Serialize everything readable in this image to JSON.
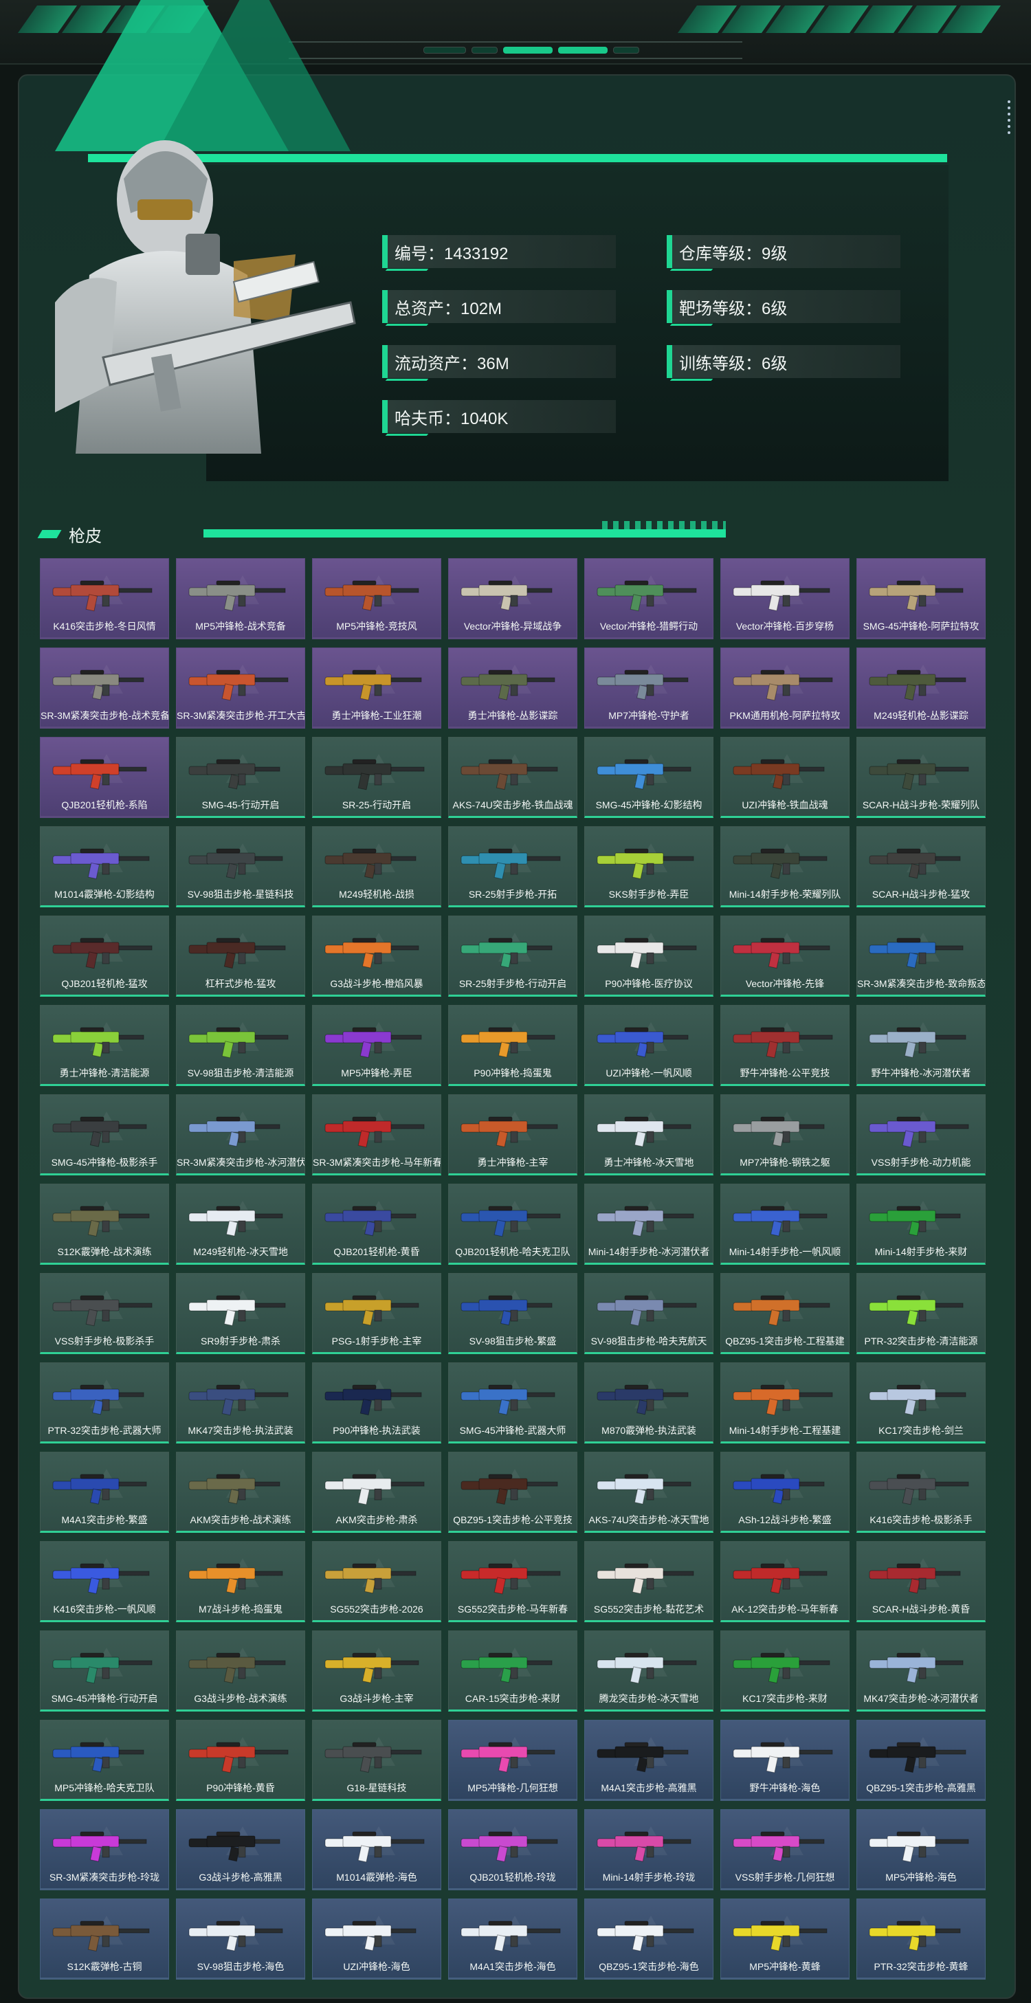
{
  "player": {
    "id": "编号：1433192",
    "total_assets": "总资产：102M",
    "liquid_assets": "流动资产：36M",
    "currency": "哈夫币：1040K",
    "warehouse_level": "仓库等级：9级",
    "range_level": "靶场等级：6级",
    "training_level": "训练等级：6级"
  },
  "section": {
    "title": "枪皮"
  },
  "colors": {
    "accent": "#1ee39c",
    "rarity_purple": "#6a548f",
    "rarity_green": "#3c5b53",
    "rarity_blue": "#44597a"
  },
  "skins": [
    {
      "name": "K416突击步枪-冬日风情",
      "rarity": "purple",
      "color": "#b24a3a"
    },
    {
      "name": "MP5冲锋枪-战术竞备",
      "rarity": "purple",
      "color": "#8a8f88"
    },
    {
      "name": "MP5冲锋枪-竞技风",
      "rarity": "purple",
      "color": "#b8552c"
    },
    {
      "name": "Vector冲锋枪-异域战争",
      "rarity": "purple",
      "color": "#c9c3b0"
    },
    {
      "name": "Vector冲锋枪-猎鳄行动",
      "rarity": "purple",
      "color": "#4f8f5a"
    },
    {
      "name": "Vector冲锋枪-百步穿杨",
      "rarity": "purple",
      "color": "#e7e7e7"
    },
    {
      "name": "SMG-45冲锋枪-阿萨拉特攻",
      "rarity": "purple",
      "color": "#b7a37a"
    },
    {
      "name": "SR-3M紧凑突击步枪-战术竞备",
      "rarity": "purple",
      "color": "#8a8a80"
    },
    {
      "name": "SR-3M紧凑突击步枪-开工大吉",
      "rarity": "purple",
      "color": "#c9552f"
    },
    {
      "name": "勇士冲锋枪-工业狂潮",
      "rarity": "purple",
      "color": "#c8952a"
    },
    {
      "name": "勇士冲锋枪-丛影谍踪",
      "rarity": "purple",
      "color": "#5c6a4a"
    },
    {
      "name": "MP7冲锋枪-守护者",
      "rarity": "purple",
      "color": "#7a8a9a"
    },
    {
      "name": "PKM通用机枪-阿萨拉特攻",
      "rarity": "purple",
      "color": "#a88b6a"
    },
    {
      "name": "M249轻机枪-丛影谍踪",
      "rarity": "purple",
      "color": "#4e5a3c"
    },
    {
      "name": "QJB201轻机枪-系陷",
      "rarity": "purple",
      "color": "#d0402a"
    },
    {
      "name": "SMG-45-行动开启",
      "rarity": "green",
      "color": "#3b3f3e"
    },
    {
      "name": "SR-25-行动开启",
      "rarity": "green",
      "color": "#2f3432"
    },
    {
      "name": "AKS-74U突击步枪-铁血战魂",
      "rarity": "green",
      "color": "#6b4a35"
    },
    {
      "name": "SMG-45冲锋枪-幻影结构",
      "rarity": "green",
      "color": "#3f8ed8"
    },
    {
      "name": "UZI冲锋枪-铁血战魂",
      "rarity": "green",
      "color": "#7a3a22"
    },
    {
      "name": "SCAR-H战斗步枪-荣耀列队",
      "rarity": "green",
      "color": "#3d4a3b"
    },
    {
      "name": "M1014霰弹枪-幻影结构",
      "rarity": "green",
      "color": "#6b5bd0"
    },
    {
      "name": "SV-98狙击步枪-星链科技",
      "rarity": "green",
      "color": "#3e4547"
    },
    {
      "name": "M249轻机枪-战损",
      "rarity": "green",
      "color": "#4a3a30"
    },
    {
      "name": "SR-25射手步枪-开拓",
      "rarity": "green",
      "color": "#2f8fb0"
    },
    {
      "name": "SKS射手步枪-弄臣",
      "rarity": "green",
      "color": "#a8d038"
    },
    {
      "name": "Mini-14射手步枪-荣耀列队",
      "rarity": "green",
      "color": "#3a4438"
    },
    {
      "name": "SCAR-H战斗步枪-猛攻",
      "rarity": "green",
      "color": "#40403e"
    },
    {
      "name": "QJB201轻机枪-猛攻",
      "rarity": "green",
      "color": "#5a2b2b"
    },
    {
      "name": "杠杆式步枪-猛攻",
      "rarity": "green",
      "color": "#4a2a24"
    },
    {
      "name": "G3战斗步枪-橙焰风暴",
      "rarity": "green",
      "color": "#e4762a"
    },
    {
      "name": "SR-25射手步枪-行动开启",
      "rarity": "green",
      "color": "#37a878"
    },
    {
      "name": "P90冲锋枪-医疗协议",
      "rarity": "green",
      "color": "#e8e8e8"
    },
    {
      "name": "Vector冲锋枪-先锋",
      "rarity": "green",
      "color": "#c03040"
    },
    {
      "name": "SR-3M紧凑突击步枪-致命叛态",
      "rarity": "green",
      "color": "#2a6bc0"
    },
    {
      "name": "勇士冲锋枪-清洁能源",
      "rarity": "green",
      "color": "#8ad03a"
    },
    {
      "name": "SV-98狙击步枪-清洁能源",
      "rarity": "green",
      "color": "#7ac43a"
    },
    {
      "name": "MP5冲锋枪-弄臣",
      "rarity": "green",
      "color": "#8a3ad0"
    },
    {
      "name": "P90冲锋枪-捣蛋鬼",
      "rarity": "green",
      "color": "#e89a2a"
    },
    {
      "name": "UZI冲锋枪-一帆风顺",
      "rarity": "green",
      "color": "#3a5ad0"
    },
    {
      "name": "野牛冲锋枪-公平竞技",
      "rarity": "green",
      "color": "#a03030"
    },
    {
      "name": "野牛冲锋枪-冰河潜伏者",
      "rarity": "green",
      "color": "#9ab0c8"
    },
    {
      "name": "SMG-45冲锋枪-极影杀手",
      "rarity": "green",
      "color": "#3a3e40"
    },
    {
      "name": "SR-3M紧凑突击步枪-冰河潜伏者",
      "rarity": "green",
      "color": "#7a9ad0"
    },
    {
      "name": "SR-3M紧凑突击步枪-马年新春",
      "rarity": "green",
      "color": "#c02a2a"
    },
    {
      "name": "勇士冲锋枪-主宰",
      "rarity": "green",
      "color": "#c85a2a"
    },
    {
      "name": "勇士冲锋枪-冰天雪地",
      "rarity": "green",
      "color": "#dfe6ee"
    },
    {
      "name": "MP7冲锋枪-钢铁之躯",
      "rarity": "green",
      "color": "#9a9ea0"
    },
    {
      "name": "VSS射手步枪-动力机能",
      "rarity": "green",
      "color": "#6a5ad0"
    },
    {
      "name": "S12K霰弹枪-战术演练",
      "rarity": "green",
      "color": "#6a6a48"
    },
    {
      "name": "M249轻机枪-冰天雪地",
      "rarity": "green",
      "color": "#e6ecf2"
    },
    {
      "name": "QJB201轻机枪-黄昏",
      "rarity": "green",
      "color": "#3a4aa0"
    },
    {
      "name": "QJB201轻机枪-哈夫克卫队",
      "rarity": "green",
      "color": "#2a56b0"
    },
    {
      "name": "Mini-14射手步枪-冰河潜伏者",
      "rarity": "green",
      "color": "#9aa6c8"
    },
    {
      "name": "Mini-14射手步枪-一帆风顺",
      "rarity": "green",
      "color": "#3a62d0"
    },
    {
      "name": "Mini-14射手步枪-来财",
      "rarity": "green",
      "color": "#2aa03a"
    },
    {
      "name": "VSS射手步枪-极影杀手",
      "rarity": "green",
      "color": "#4a4e50"
    },
    {
      "name": "SR9射手步枪-肃杀",
      "rarity": "green",
      "color": "#eef2f4"
    },
    {
      "name": "PSG-1射手步枪-主宰",
      "rarity": "green",
      "color": "#c8a02a"
    },
    {
      "name": "SV-98狙击步枪-繁盛",
      "rarity": "green",
      "color": "#2a52b0"
    },
    {
      "name": "SV-98狙击步枪-哈夫克航天",
      "rarity": "green",
      "color": "#7a8ab0"
    },
    {
      "name": "QBZ95-1突击步枪-工程基建",
      "rarity": "green",
      "color": "#d0702a"
    },
    {
      "name": "PTR-32突击步枪-清洁能源",
      "rarity": "green",
      "color": "#8ae03a"
    },
    {
      "name": "PTR-32突击步枪-武器大师",
      "rarity": "green",
      "color": "#3a62c0"
    },
    {
      "name": "MK47突击步枪-执法武装",
      "rarity": "green",
      "color": "#3a4e80"
    },
    {
      "name": "P90冲锋枪-执法武装",
      "rarity": "green",
      "color": "#1a2850"
    },
    {
      "name": "SMG-45冲锋枪-武器大师",
      "rarity": "green",
      "color": "#3a72c8"
    },
    {
      "name": "M870霰弹枪-执法武装",
      "rarity": "green",
      "color": "#2a3a68"
    },
    {
      "name": "Mini-14射手步枪-工程基建",
      "rarity": "green",
      "color": "#d86a2a"
    },
    {
      "name": "KC17突击步枪-剑兰",
      "rarity": "green",
      "color": "#b8c8e0"
    },
    {
      "name": "M4A1突击步枪-繁盛",
      "rarity": "green",
      "color": "#2a4ab0"
    },
    {
      "name": "AKM突击步枪-战术演练",
      "rarity": "green",
      "color": "#6a6a4a"
    },
    {
      "name": "AKM突击步枪-肃杀",
      "rarity": "green",
      "color": "#e8ecee"
    },
    {
      "name": "QBZ95-1突击步枪-公平竞技",
      "rarity": "green",
      "color": "#4a2a20"
    },
    {
      "name": "AKS-74U突击步枪-冰天雪地",
      "rarity": "green",
      "color": "#d8e4f0"
    },
    {
      "name": "ASh-12战斗步枪-繁盛",
      "rarity": "green",
      "color": "#2a4ac0"
    },
    {
      "name": "K416突击步枪-极影杀手",
      "rarity": "green",
      "color": "#4a4e52"
    },
    {
      "name": "K416突击步枪-一帆风顺",
      "rarity": "green",
      "color": "#3a5ae0"
    },
    {
      "name": "M7战斗步枪-捣蛋鬼",
      "rarity": "green",
      "color": "#e8902a"
    },
    {
      "name": "SG552突击步枪-2026",
      "rarity": "green",
      "color": "#c8a03a"
    },
    {
      "name": "SG552突击步枪-马年新春",
      "rarity": "green",
      "color": "#c82a2a"
    },
    {
      "name": "SG552突击步枪-黏花艺术",
      "rarity": "green",
      "color": "#e8e2dc"
    },
    {
      "name": "AK-12突击步枪-马年新春",
      "rarity": "green",
      "color": "#c02a2a"
    },
    {
      "name": "SCAR-H战斗步枪-黄昏",
      "rarity": "green",
      "color": "#a82a30"
    },
    {
      "name": "SMG-45冲锋枪-行动开启",
      "rarity": "green",
      "color": "#2a8a6a"
    },
    {
      "name": "G3战斗步枪-战术演练",
      "rarity": "green",
      "color": "#5a5a40"
    },
    {
      "name": "G3战斗步枪-主宰",
      "rarity": "green",
      "color": "#d8b02a"
    },
    {
      "name": "CAR-15突击步枪-来财",
      "rarity": "green",
      "color": "#2aa04a"
    },
    {
      "name": "腾龙突击步枪-冰天雪地",
      "rarity": "green",
      "color": "#d8e4ee"
    },
    {
      "name": "KC17突击步枪-来财",
      "rarity": "green",
      "color": "#2aa03a"
    },
    {
      "name": "MK47突击步枪-冰河潜伏者",
      "rarity": "green",
      "color": "#9ab4d8"
    },
    {
      "name": "MP5冲锋枪-哈夫克卫队",
      "rarity": "green",
      "color": "#2a5ac0"
    },
    {
      "name": "P90冲锋枪-黄昏",
      "rarity": "green",
      "color": "#c83a2a"
    },
    {
      "name": "G18-星链科技",
      "rarity": "green",
      "color": "#4a4e50"
    },
    {
      "name": "MP5冲锋枪-几何狂想",
      "rarity": "blue",
      "color": "#e84ab0"
    },
    {
      "name": "M4A1突击步枪-高雅黑",
      "rarity": "blue",
      "color": "#1a1c1e"
    },
    {
      "name": "野牛冲锋枪-海色",
      "rarity": "blue",
      "color": "#f0f2f4"
    },
    {
      "name": "QBZ95-1突击步枪-高雅黑",
      "rarity": "blue",
      "color": "#1a1c1e"
    },
    {
      "name": "SR-3M紧凑突击步枪-玲珑",
      "rarity": "blue",
      "color": "#c83ad8"
    },
    {
      "name": "G3战斗步枪-高雅黑",
      "rarity": "blue",
      "color": "#1c1e20"
    },
    {
      "name": "M1014霰弹枪-海色",
      "rarity": "blue",
      "color": "#eef2f6"
    },
    {
      "name": "QJB201轻机枪-玲珑",
      "rarity": "blue",
      "color": "#c84ad0"
    },
    {
      "name": "Mini-14射手步枪-玲珑",
      "rarity": "blue",
      "color": "#d84aa8"
    },
    {
      "name": "VSS射手步枪-几何狂想",
      "rarity": "blue",
      "color": "#d84ac8"
    },
    {
      "name": "MP5冲锋枪-海色",
      "rarity": "blue",
      "color": "#eef2f6"
    },
    {
      "name": "S12K霰弹枪-古铜",
      "rarity": "blue",
      "color": "#7a5a3a"
    },
    {
      "name": "SV-98狙击步枪-海色",
      "rarity": "blue",
      "color": "#e8eef4"
    },
    {
      "name": "UZI冲锋枪-海色",
      "rarity": "blue",
      "color": "#eef2f6"
    },
    {
      "name": "M4A1突击步枪-海色",
      "rarity": "blue",
      "color": "#e8eef4"
    },
    {
      "name": "QBZ95-1突击步枪-海色",
      "rarity": "blue",
      "color": "#eef2f6"
    },
    {
      "name": "MP5冲锋枪-黄蜂",
      "rarity": "blue",
      "color": "#e8d82a"
    },
    {
      "name": "PTR-32突击步枪-黄蜂",
      "rarity": "blue",
      "color": "#e8d82a"
    }
  ]
}
